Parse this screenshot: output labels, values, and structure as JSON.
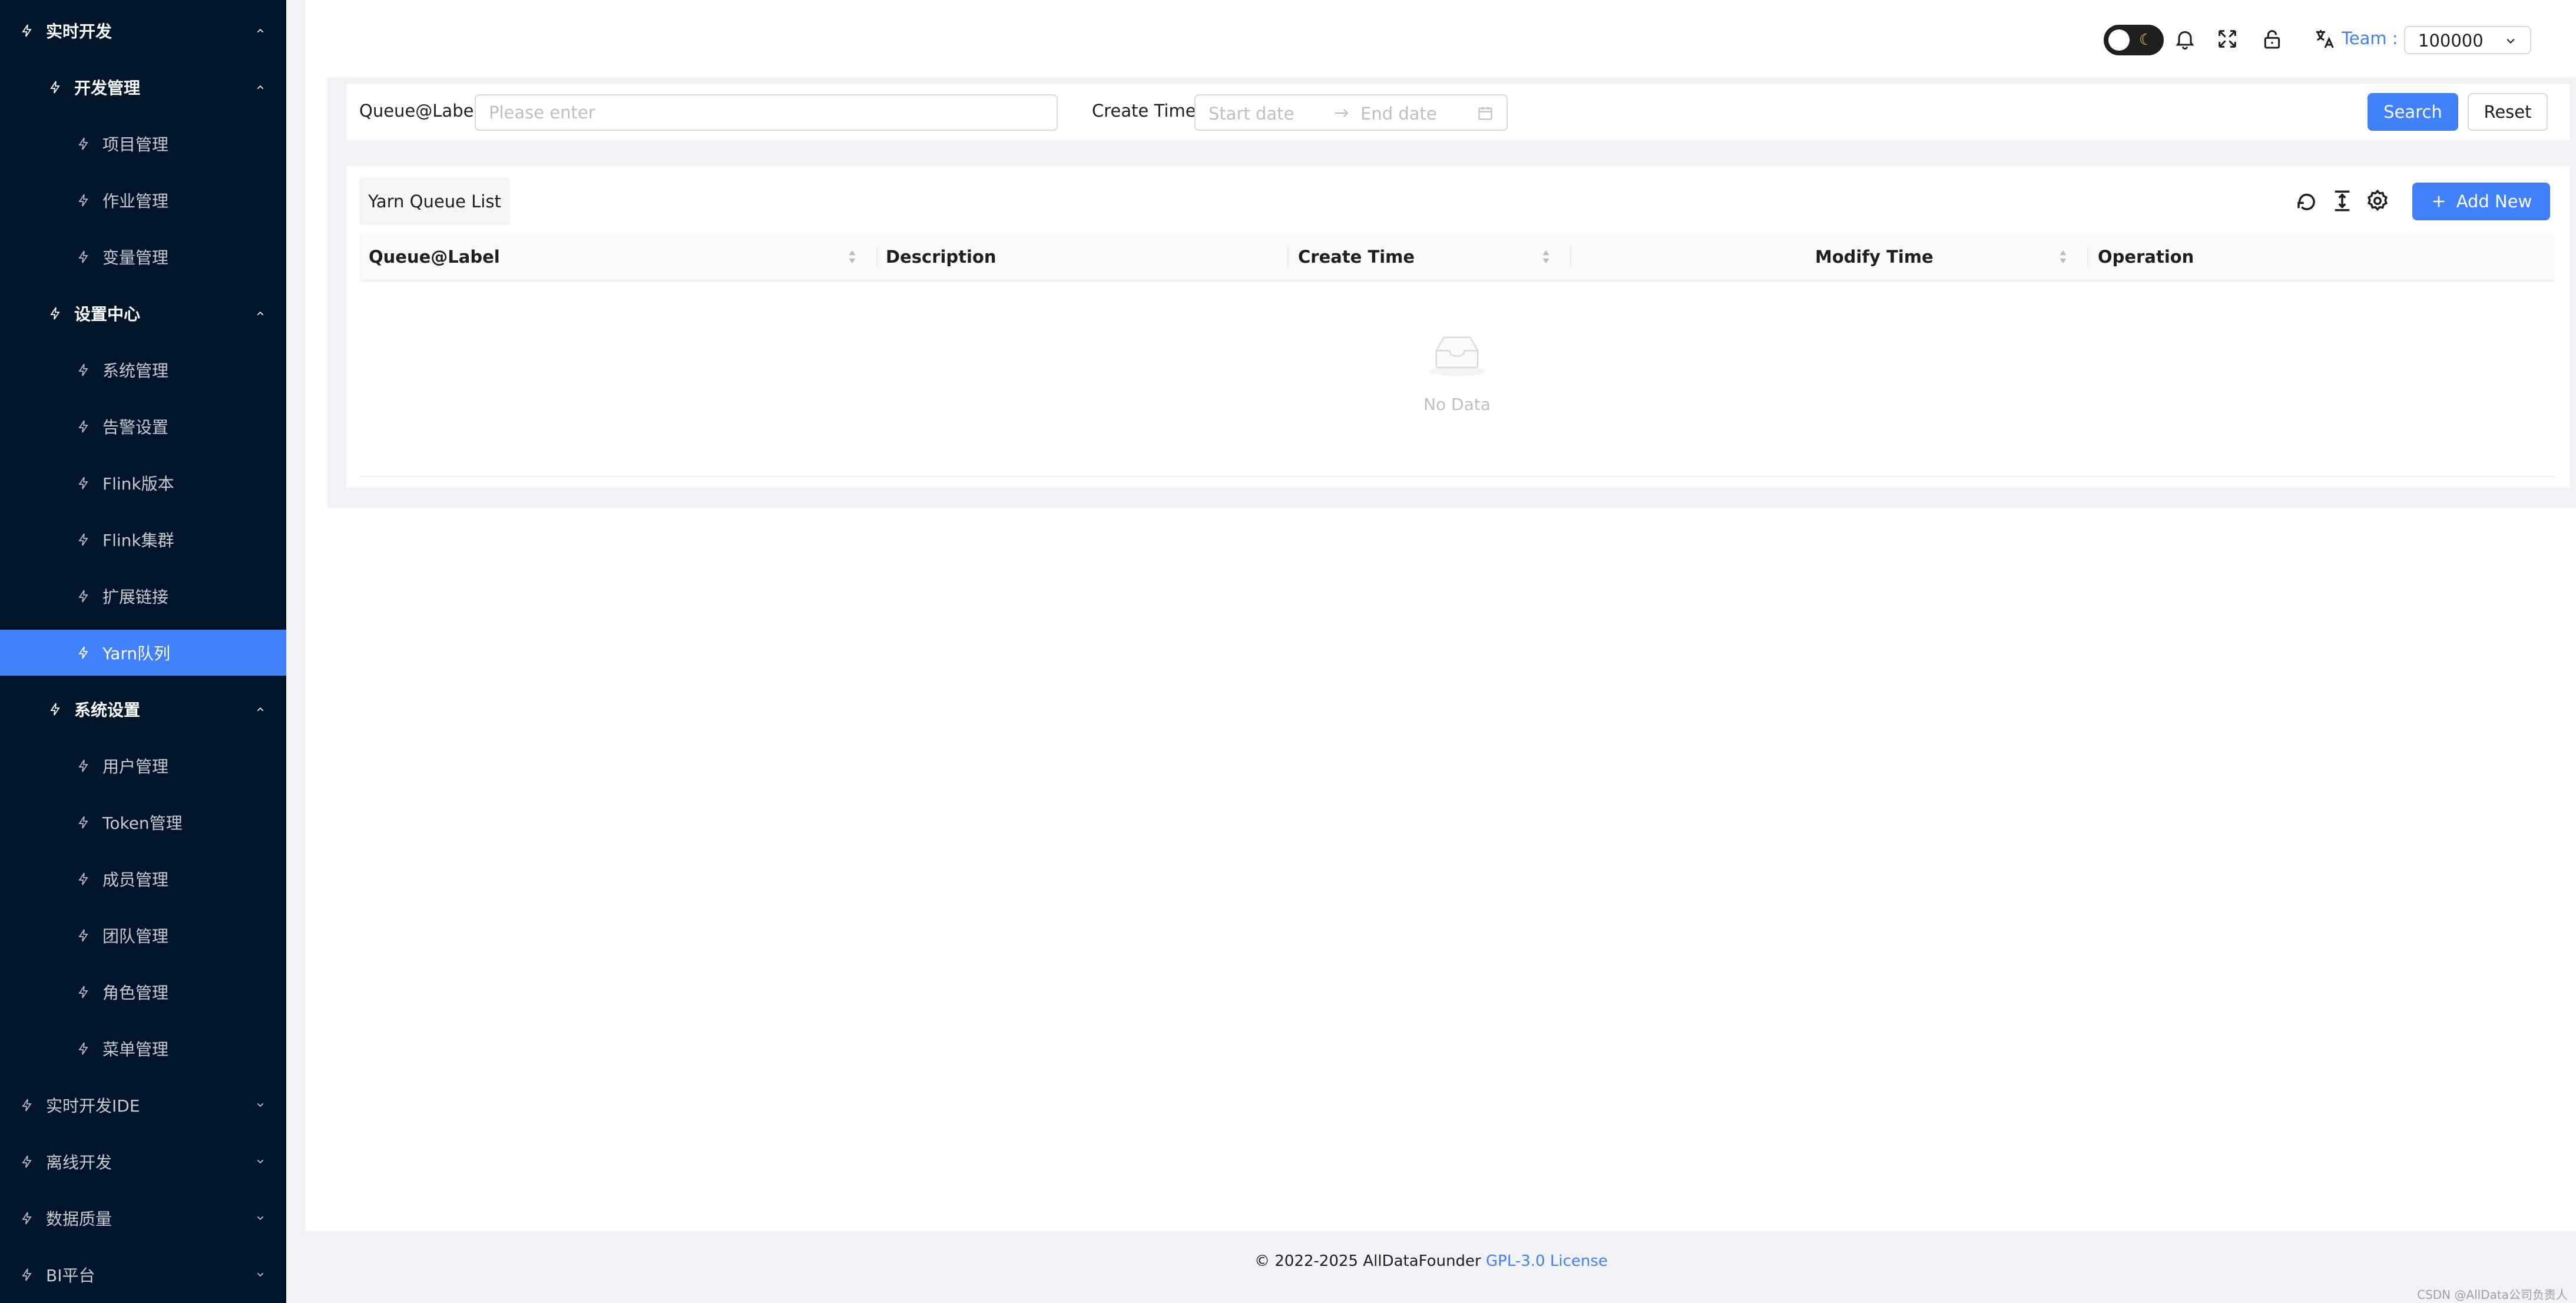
{
  "sidebar": {
    "items": [
      {
        "label": "实时开发",
        "level": 0,
        "kind": "group-open"
      },
      {
        "label": "开发管理",
        "level": 1,
        "kind": "group-open"
      },
      {
        "label": "项目管理",
        "level": 2,
        "kind": "item"
      },
      {
        "label": "作业管理",
        "level": 2,
        "kind": "item"
      },
      {
        "label": "变量管理",
        "level": 2,
        "kind": "item"
      },
      {
        "label": "设置中心",
        "level": 1,
        "kind": "group-open"
      },
      {
        "label": "系统管理",
        "level": 2,
        "kind": "item"
      },
      {
        "label": "告警设置",
        "level": 2,
        "kind": "item"
      },
      {
        "label": "Flink版本",
        "level": 2,
        "kind": "item"
      },
      {
        "label": "Flink集群",
        "level": 2,
        "kind": "item"
      },
      {
        "label": "扩展链接",
        "level": 2,
        "kind": "item"
      },
      {
        "label": "Yarn队列",
        "level": 2,
        "kind": "active"
      },
      {
        "label": "系统设置",
        "level": 1,
        "kind": "group-open"
      },
      {
        "label": "用户管理",
        "level": 2,
        "kind": "item"
      },
      {
        "label": "Token管理",
        "level": 2,
        "kind": "item"
      },
      {
        "label": "成员管理",
        "level": 2,
        "kind": "item"
      },
      {
        "label": "团队管理",
        "level": 2,
        "kind": "item"
      },
      {
        "label": "角色管理",
        "level": 2,
        "kind": "item"
      },
      {
        "label": "菜单管理",
        "level": 2,
        "kind": "item"
      },
      {
        "label": "实时开发IDE",
        "level": 0,
        "kind": "group-closed"
      },
      {
        "label": "离线开发",
        "level": 0,
        "kind": "group-closed"
      },
      {
        "label": "数据质量",
        "level": 0,
        "kind": "group-closed"
      },
      {
        "label": "BI平台",
        "level": 0,
        "kind": "group-closed"
      }
    ]
  },
  "header": {
    "team_label": "Team :",
    "team_value": "100000"
  },
  "search": {
    "queue_label": "Queue@Label",
    "queue_placeholder": "Please enter",
    "create_time_label": "Create Time",
    "start_placeholder": "Start date",
    "end_placeholder": "End date",
    "search_button": "Search",
    "reset_button": "Reset"
  },
  "table": {
    "title": "Yarn Queue List",
    "add_button": "Add New",
    "columns": [
      "Queue@Label",
      "Description",
      "Create Time",
      "Modify Time",
      "Operation"
    ],
    "empty_text": "No Data"
  },
  "footer": {
    "copyright": "© 2022-2025 AllDataFounder ",
    "license_link": "GPL-3.0 License",
    "watermark": "CSDN @AllData公司负责人"
  },
  "colors": {
    "sidebar_bg": "#001529",
    "accent": "#4080f8"
  }
}
